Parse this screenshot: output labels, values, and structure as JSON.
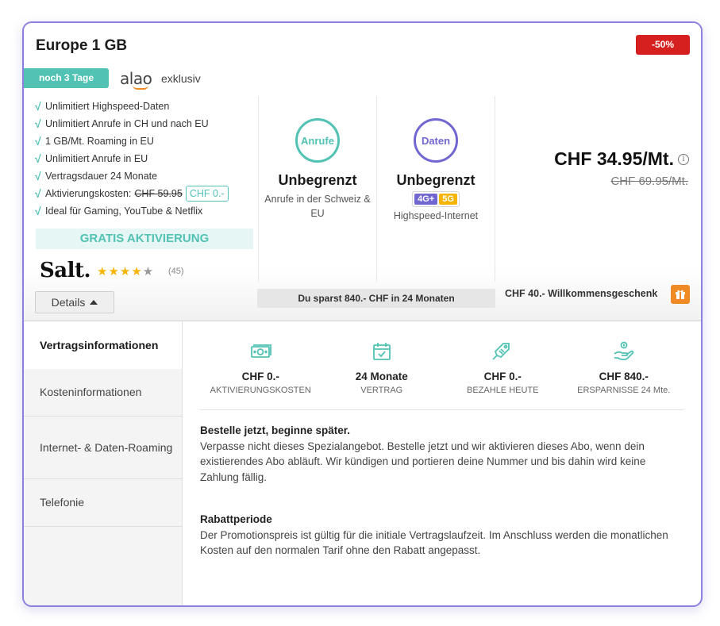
{
  "header": {
    "title": "Europe 1 GB",
    "discount": "-50%",
    "days_badge": "noch 3 Tage",
    "brand": "alao",
    "exclusive": "exklusiv"
  },
  "features": {
    "items": [
      "Unlimitiert Highspeed-Daten",
      "Unlimitiert Anrufe in CH und nach EU",
      "1 GB/Mt. Roaming in EU",
      "Unlimitiert Anrufe in EU",
      "Vertragsdauer 24 Monate"
    ],
    "activation_label": "Aktivierungskosten:",
    "activation_old": "CHF 59.95",
    "activation_new": "CHF 0.-",
    "gaming": "Ideal für Gaming, YouTube & Netflix",
    "check": "√",
    "gratis": "GRATIS AKTIVIERUNG"
  },
  "provider": {
    "name": "Salt.",
    "stars_full": "★★★★",
    "stars_empty": "★",
    "rating": 4,
    "reviews": "(45)"
  },
  "details_button": "Details",
  "calls": {
    "circle": "Anrufe",
    "title": "Unbegrenzt",
    "subtitle": "Anrufe in der Schweiz & EU",
    "color": "#52c2b4"
  },
  "data": {
    "circle": "Daten",
    "title": "Unbegrenzt",
    "badge_4g": "4G+",
    "badge_5g": "5G",
    "subtitle": "Highspeed-Internet",
    "color": "#7167d0"
  },
  "pricing": {
    "price": "CHF 34.95/Mt.",
    "old_price": "CHF 69.95/Mt.",
    "info": "i",
    "savings": "Du sparst 840.- CHF in 24 Monaten",
    "gift": "CHF 40.- Willkommensgeschenk"
  },
  "tabs": [
    "Vertragsinformationen",
    "Kosteninformationen",
    "Internet- & Daten-Roaming",
    "Telefonie"
  ],
  "stats": [
    {
      "icon": "money-icon",
      "value": "CHF 0.-",
      "label": "AKTIVIERUNGSKOSTEN"
    },
    {
      "icon": "calendar-check-icon",
      "value": "24 Monate",
      "label": "VERTRAG"
    },
    {
      "icon": "price-tag-icon",
      "value": "CHF 0.-",
      "label": "BEZAHLE HEUTE"
    },
    {
      "icon": "savings-hand-icon",
      "value": "CHF 840.-",
      "label": "ERSPARNISSE 24 Mte."
    }
  ],
  "sections": [
    {
      "title": "Bestelle jetzt, beginne später.",
      "text": "Verpasse nicht dieses Spezialangebot. Bestelle jetzt und wir aktivieren dieses Abo, wenn dein existierendes Abo abläuft. Wir kündigen und portieren deine Nummer und bis dahin wird keine Zahlung fällig."
    },
    {
      "title": "Rabattperiode",
      "text": "Der Promotionspreis ist gültig für die initiale Vertragslaufzeit. Im Anschluss werden die monatlichen Kosten auf den normalen Tarif ohne den Rabatt angepasst."
    }
  ],
  "colors": {
    "accent_teal": "#52c2b4",
    "accent_purple": "#7167d0",
    "discount_red": "#d61f1f",
    "gift_orange": "#f08a24",
    "card_border": "#8b7fe0"
  }
}
